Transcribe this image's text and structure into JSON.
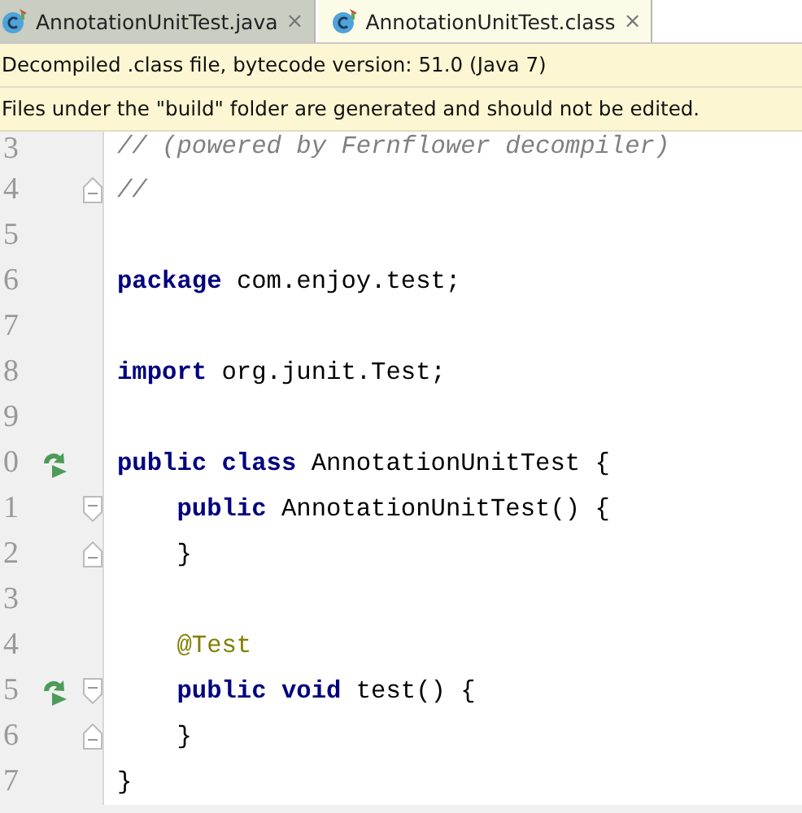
{
  "tabs": [
    {
      "label": "AnnotationUnitTest.java",
      "close": "×",
      "selected": false
    },
    {
      "label": "AnnotationUnitTest.class",
      "close": "×",
      "selected": true
    }
  ],
  "banners": [
    "Decompiled .class file, bytecode version: 51.0 (Java 7)",
    "Files under the \"build\" folder are generated and should not be edited."
  ],
  "editor": {
    "lines": [
      {
        "number": "3",
        "tokens": [
          {
            "kind": "comment",
            "text": "// (powered by Fernflower decompiler)"
          }
        ]
      },
      {
        "number": "4",
        "fold_end": true,
        "tokens": [
          {
            "kind": "comment",
            "text": "//"
          }
        ]
      },
      {
        "number": "5"
      },
      {
        "number": "6",
        "tokens": [
          {
            "kind": "keyword",
            "text": "package"
          },
          {
            "kind": "plain",
            "text": " com.enjoy.test;"
          }
        ]
      },
      {
        "number": "7"
      },
      {
        "number": "8",
        "tokens": [
          {
            "kind": "keyword",
            "text": "import"
          },
          {
            "kind": "plain",
            "text": " org.junit.Test;"
          }
        ]
      },
      {
        "number": "9"
      },
      {
        "number": "0",
        "run_icon": true,
        "tokens": [
          {
            "kind": "keyword",
            "text": "public class"
          },
          {
            "kind": "plain",
            "text": " AnnotationUnitTest {"
          }
        ]
      },
      {
        "number": "1",
        "fold_start": true,
        "tokens": [
          {
            "kind": "keyword",
            "text": "    public"
          },
          {
            "kind": "plain",
            "text": " AnnotationUnitTest() {"
          }
        ]
      },
      {
        "number": "2",
        "fold_end": true,
        "tokens": [
          {
            "kind": "plain",
            "text": "    }"
          }
        ]
      },
      {
        "number": "3"
      },
      {
        "number": "4",
        "tokens": [
          {
            "kind": "annotation",
            "text": "    @Test"
          }
        ]
      },
      {
        "number": "5",
        "run_icon": true,
        "fold_start": true,
        "tokens": [
          {
            "kind": "keyword",
            "text": "    public void"
          },
          {
            "kind": "plain",
            "text": " test() {"
          }
        ]
      },
      {
        "number": "6",
        "fold_end": true,
        "tokens": [
          {
            "kind": "plain",
            "text": "    }"
          }
        ]
      },
      {
        "number": "7",
        "tokens": [
          {
            "kind": "plain",
            "text": "}"
          }
        ]
      }
    ]
  }
}
